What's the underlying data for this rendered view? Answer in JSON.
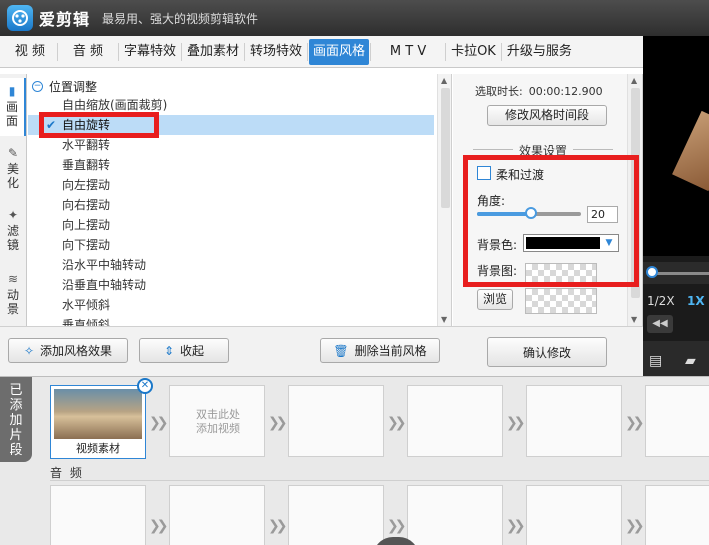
{
  "app": {
    "name": "爱剪辑",
    "slogan": "最易用、强大的视频剪辑软件"
  },
  "tabs": [
    {
      "label": "视 频"
    },
    {
      "label": "音 频"
    },
    {
      "label": "字幕特效"
    },
    {
      "label": "叠加素材"
    },
    {
      "label": "转场特效"
    },
    {
      "label": "画面风格"
    },
    {
      "label": "M T V"
    },
    {
      "label": "卡拉OK"
    },
    {
      "label": "升级与服务"
    }
  ],
  "active_tab": "画面风格",
  "side_tabs": [
    {
      "label": "画面",
      "icon": "picture-icon"
    },
    {
      "label": "美化",
      "icon": "magic-wand-icon"
    },
    {
      "label": "滤镜",
      "icon": "sparkle-icon"
    },
    {
      "label": "动景",
      "icon": "wave-icon"
    }
  ],
  "style_list": {
    "group": "位置调整",
    "items": [
      "自由缩放(画面裁剪)",
      "自由旋转",
      "水平翻转",
      "垂直翻转",
      "向左摆动",
      "向右摆动",
      "向上摆动",
      "向下摆动",
      "沿水平中轴转动",
      "沿垂直中轴转动",
      "水平倾斜",
      "垂直倾斜"
    ],
    "selected": "自由旋转"
  },
  "settings": {
    "duration_label": "选取时长:",
    "duration_value": "00:00:12.900",
    "modify_time_button": "修改风格时间段",
    "effect_title": "效果设置",
    "soft_transition_label": "柔和过渡",
    "soft_transition_checked": false,
    "angle_label": "角度:",
    "angle_value": "20",
    "angle_slider_fraction": 0.52,
    "bg_color_label": "背景色:",
    "bg_color": "#000000",
    "bg_image_label": "背景图:",
    "browse_button": "浏览"
  },
  "actions": {
    "add_effect": "添加风格效果",
    "collapse": "收起",
    "delete_current": "删除当前风格",
    "confirm": "确认修改"
  },
  "preview": {
    "speed_half": "1/2X",
    "speed_one": "1X"
  },
  "timeline": {
    "added_label": [
      "已",
      "添",
      "加",
      "片",
      "段"
    ],
    "video_clip_label": "视频素材",
    "add_hint_line1": "双击此处",
    "add_hint_line2": "添加视频",
    "audio_label": "音 频"
  },
  "colors": {
    "accent": "#2f86d6",
    "highlight": "#e81e1e",
    "title_bar": "#3a3a3a"
  }
}
